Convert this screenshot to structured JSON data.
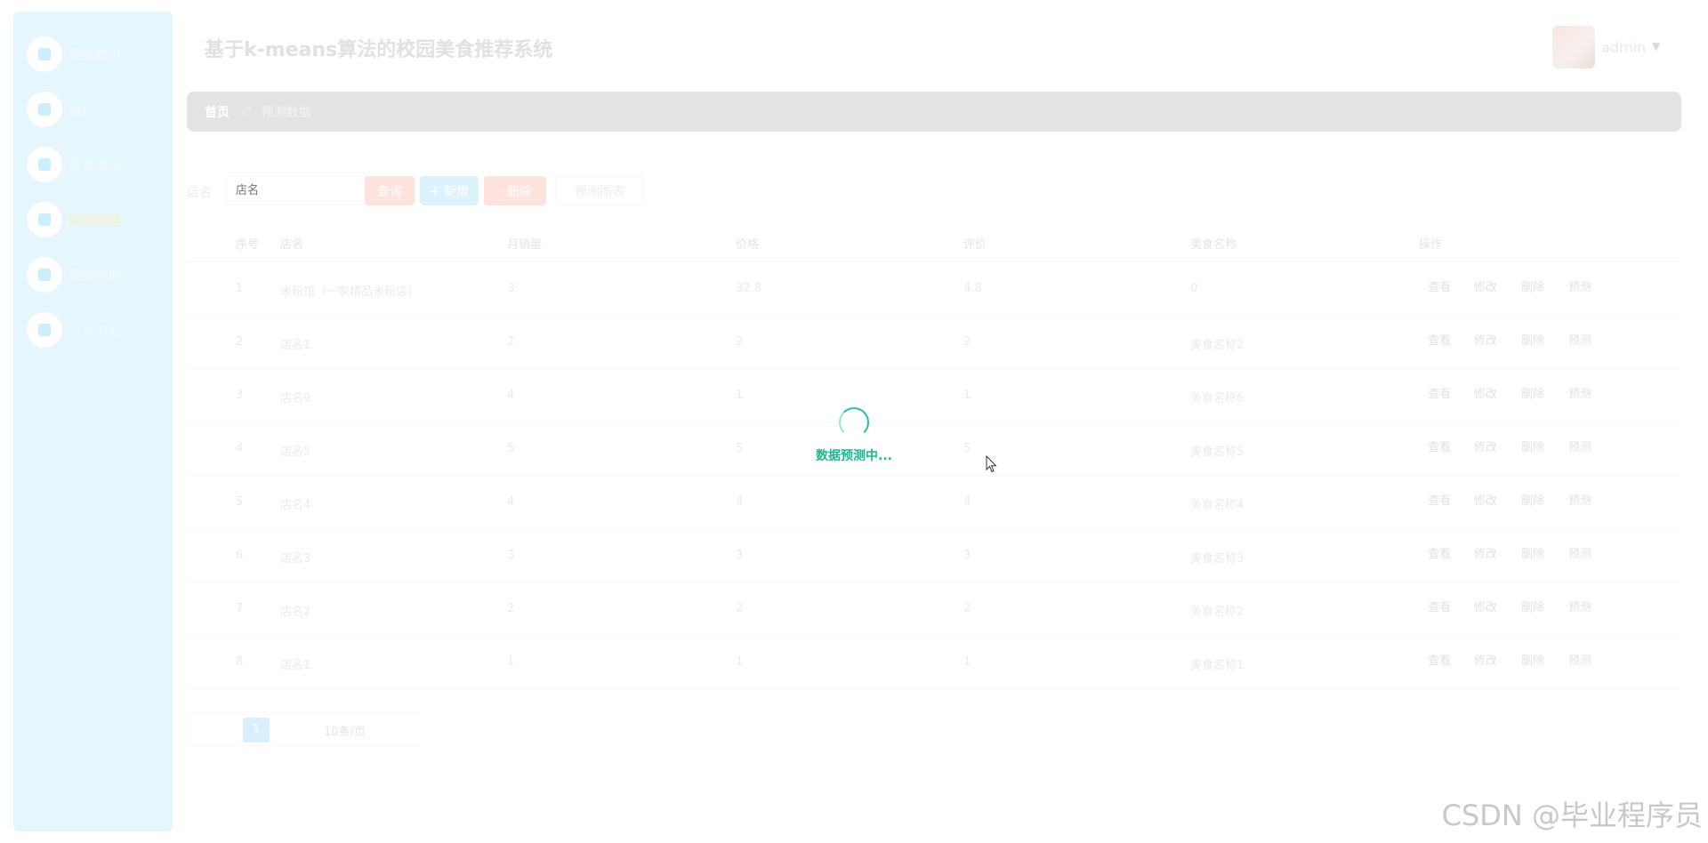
{
  "sidebar": {
    "items": [
      {
        "label": "系统首页",
        "active": false
      },
      {
        "label": "用户",
        "active": false
      },
      {
        "label": "美食管理",
        "active": false
      },
      {
        "label": "预测数据",
        "active": true
      },
      {
        "label": "系统管理",
        "active": false
      },
      {
        "label": "个人中心",
        "active": false,
        "caret": "›"
      }
    ]
  },
  "header": {
    "title": "基于k-means算法的校园美食推荐系统",
    "user": "admin",
    "caret": "▼"
  },
  "breadcrumb": {
    "home": "首页",
    "separator": "⤢",
    "current": "预测数据"
  },
  "search": {
    "label": "店名",
    "placeholder": "店名",
    "search_btn": "查询",
    "add_btn": "+ 新增",
    "delete_btn": "- 删除",
    "chart_btn": "预测图表"
  },
  "table": {
    "headers": [
      "序号",
      "店名",
      "月销量",
      "价格",
      "评价",
      "美食名称",
      "操作"
    ],
    "rows": [
      [
        "1",
        "米粉馆（一家精品米粉店）",
        "3",
        "32.8",
        "4.8",
        "0"
      ],
      [
        "2",
        "店名1",
        "2",
        "2",
        "2",
        "美食名称2"
      ],
      [
        "3",
        "店名9",
        "4",
        "1",
        "1",
        "美食名称6"
      ],
      [
        "4",
        "店名5",
        "5",
        "5",
        "5",
        "美食名称5"
      ],
      [
        "5",
        "店名4",
        "4",
        "4",
        "4",
        "美食名称4"
      ],
      [
        "6",
        "店名3",
        "3",
        "3",
        "3",
        "美食名称3"
      ],
      [
        "7",
        "店名2",
        "2",
        "2",
        "2",
        "美食名称2"
      ],
      [
        "8",
        "店名1",
        "1",
        "1",
        "1",
        "美食名称1"
      ]
    ],
    "actions": [
      "查看",
      "修改",
      "删除",
      "预测"
    ]
  },
  "pagination": {
    "current_page": "1",
    "page_size": "10条/页"
  },
  "loading": {
    "text": "数据预测中..."
  },
  "watermark": "CSDN @毕业程序员",
  "colors": {
    "accent_green": "#21b68c",
    "sidebar_bg": "#e6f6fd"
  }
}
